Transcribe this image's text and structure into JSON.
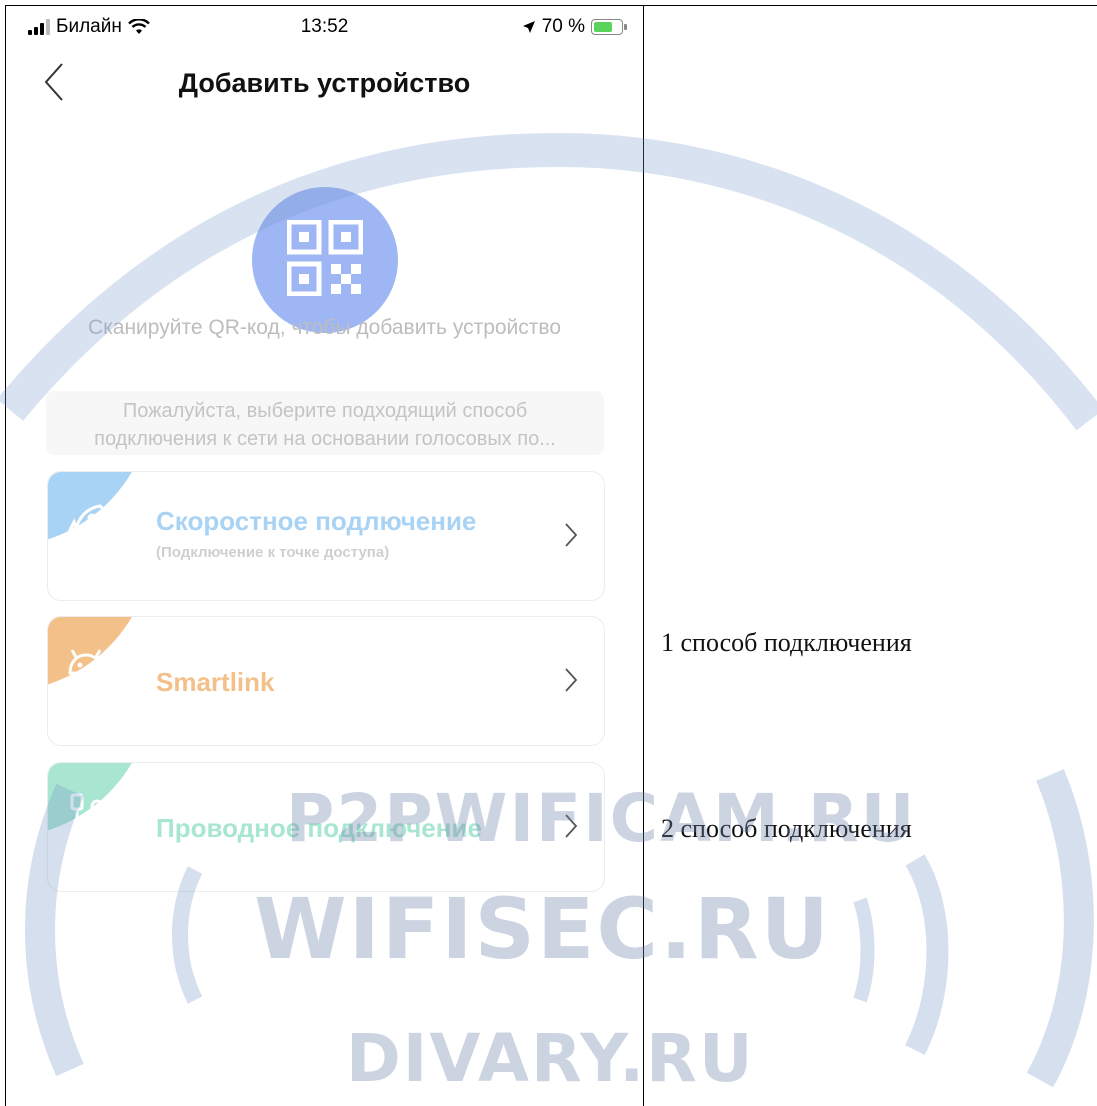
{
  "status_bar": {
    "carrier": "Билайн",
    "time": "13:52",
    "battery": "70 %",
    "battery_level": 0.7
  },
  "nav": {
    "title": "Добавить устройство"
  },
  "qr": {
    "icon": "qr-code-icon",
    "caption": "Сканируйте QR-код, чтобы добавить устройство"
  },
  "hint": {
    "line1": "Пожалуйста, выберите подходящий способ",
    "line2": "подключения к сети на основании голосовых по..."
  },
  "options": [
    {
      "title": "Скоростное подлючение",
      "subtitle": "(Подключение к точке доступа)",
      "icon": "rocket-icon",
      "color": "#a9d3f4",
      "title_color": "#a9d3f4"
    },
    {
      "title": "Smartlink",
      "icon": "android-icon",
      "color": "#f3c08a",
      "title_color": "#f3c08a"
    },
    {
      "title": "Проводное подключение",
      "icon": "cable-icon",
      "color": "#a8e6d2",
      "title_color": "#a8e6d2"
    }
  ],
  "doc_notes": {
    "note1": "1 способ подключения",
    "note2": "2 способ подключения"
  },
  "watermark": {
    "line1": "P2PWIFICAM.RU",
    "line2": "WIFISEC.RU",
    "line3": "DIVARY.RU"
  }
}
